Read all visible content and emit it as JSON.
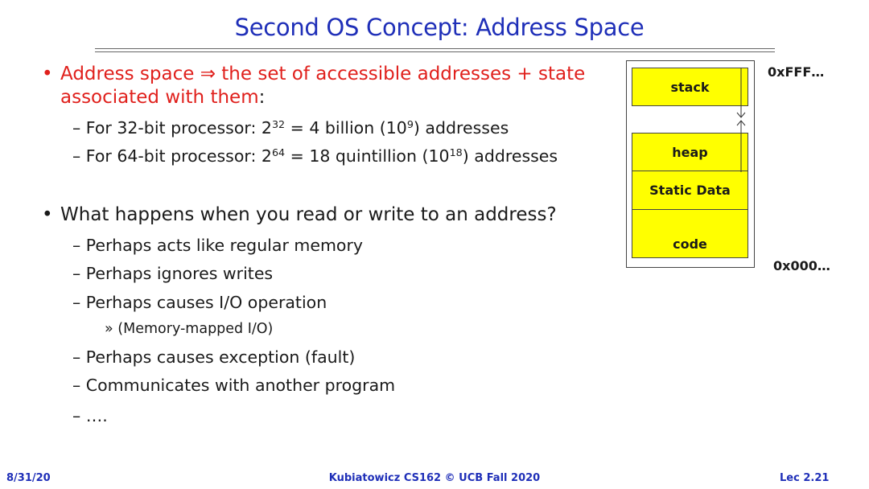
{
  "title": "Second OS Concept: Address Space",
  "bullets": [
    {
      "marker": "•",
      "line1": "Address space ⇒ the set of accessible addresses + state",
      "line2_red": "associated with them",
      "line2_tail": ":",
      "subitems": [
        {
          "dash": "–",
          "pre": "For 32-bit processor: 2",
          "sup1": "32",
          "mid": " = 4 billion (10",
          "sup2": "9",
          "post": ")  addresses"
        },
        {
          "dash": "–",
          "pre": "For 64-bit processor: 2",
          "sup1": "64",
          "mid": " = 18 quintillion (10",
          "sup2": "18",
          "post": ") addresses"
        }
      ]
    },
    {
      "marker": "•",
      "line1": "What happens when you read or write to an address?",
      "subitems": [
        {
          "dash": "–",
          "text": "Perhaps acts like regular memory"
        },
        {
          "dash": "–",
          "text": "Perhaps ignores writes"
        },
        {
          "dash": "–",
          "text": "Perhaps causes I/O operation"
        },
        {
          "dash": "»",
          "text": "(Memory-mapped I/O)"
        },
        {
          "dash": "–",
          "text": "Perhaps causes exception (fault)"
        },
        {
          "dash": "–",
          "text": "Communicates with another program"
        },
        {
          "dash": "–",
          "text": "…."
        }
      ]
    }
  ],
  "diagram": {
    "segments": {
      "stack": "stack",
      "heap": "heap",
      "static": "Static Data",
      "code": "code"
    },
    "addr_high": "0xFFF…",
    "addr_low": "0x000…",
    "colors": {
      "segment_fill": "#ffff00",
      "title": "#1f2fb8",
      "emphasis": "#e0201c"
    }
  },
  "footer": {
    "date": "8/31/20",
    "course": "Kubiatowicz CS162 © UCB Fall 2020",
    "lecture": "Lec 2.21"
  }
}
